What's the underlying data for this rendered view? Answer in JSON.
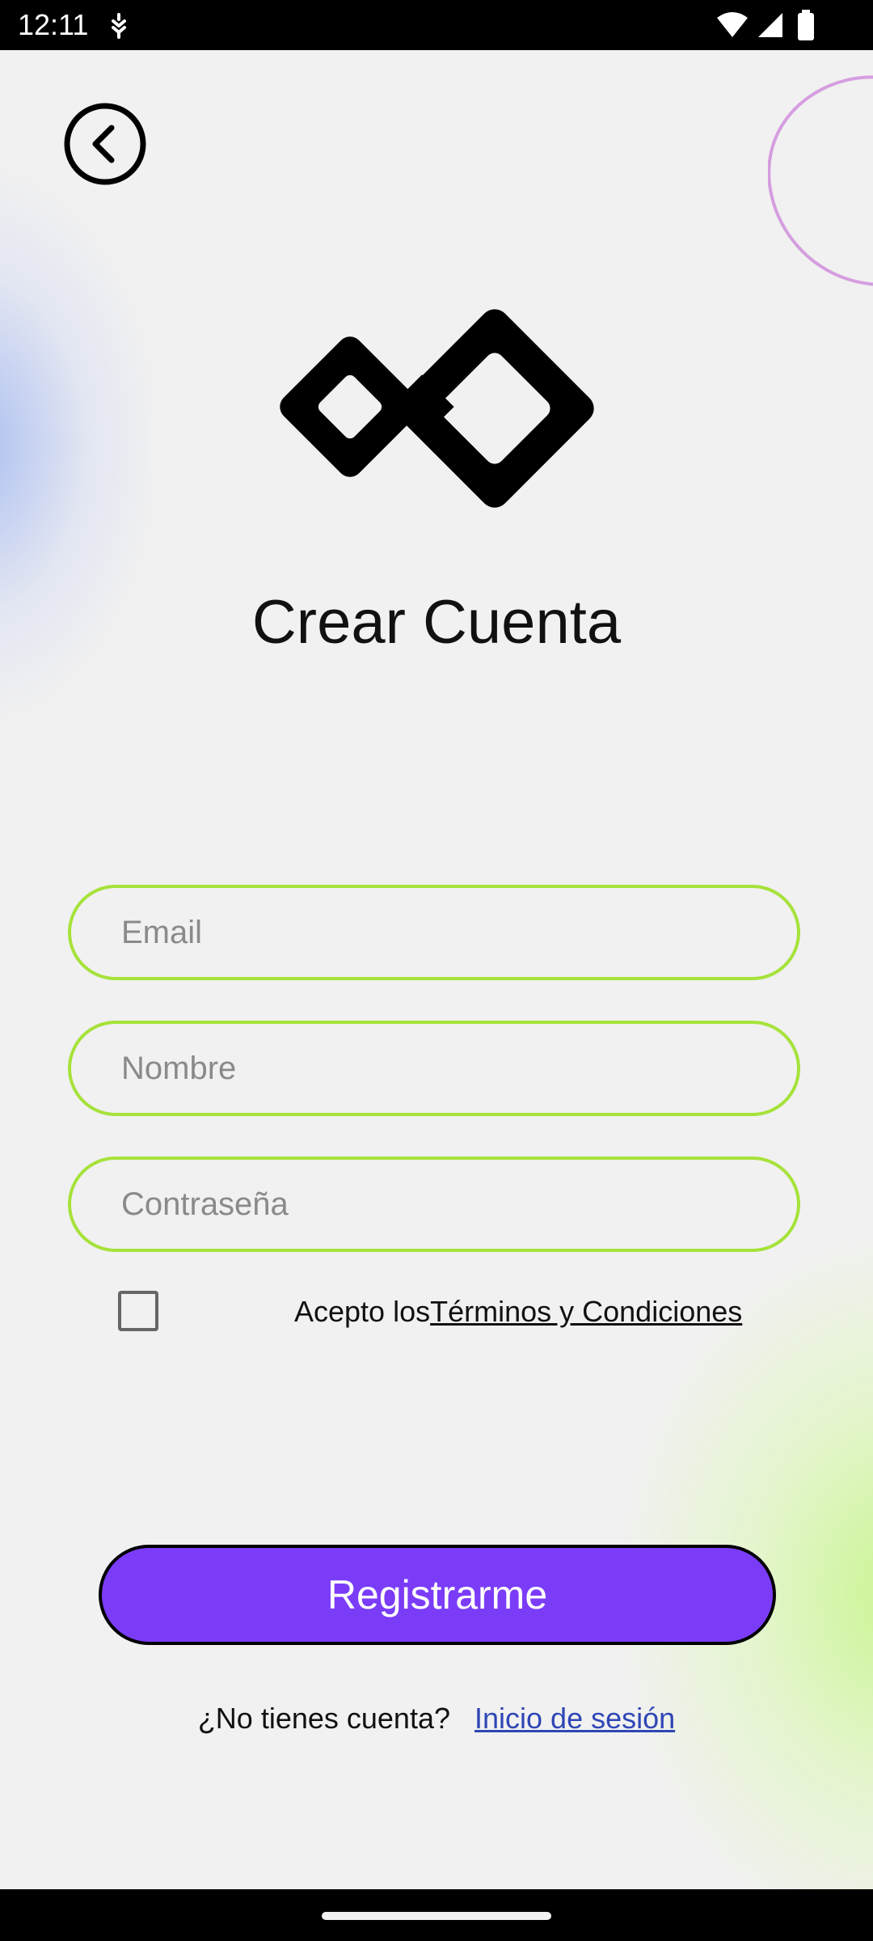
{
  "status_bar": {
    "time": "12:11",
    "icons": [
      "notification-icon",
      "wifi-icon",
      "signal-icon",
      "battery-icon"
    ]
  },
  "header": {
    "back_icon": "chevron-left-circle-icon"
  },
  "main": {
    "title": "Crear Cuenta",
    "fields": {
      "email_placeholder": "Email",
      "name_placeholder": "Nombre",
      "password_placeholder": "Contraseña"
    },
    "terms": {
      "prefix": "Acepto los",
      "link": "Términos y Condiciones",
      "checked": false
    },
    "register_label": "Registrarme",
    "login_prompt": "¿No tienes cuenta?",
    "login_link": "Inicio de sesión"
  },
  "colors": {
    "background": "#f1f1f1",
    "field_border": "#a6e23a",
    "primary_button": "#7b3cf8",
    "link": "#2f46b5"
  }
}
